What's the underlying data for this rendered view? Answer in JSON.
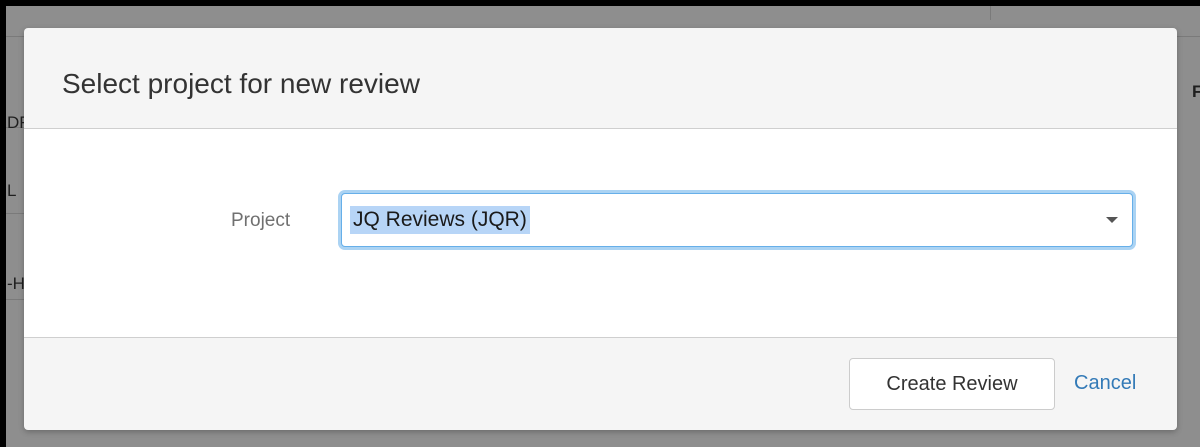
{
  "dialog": {
    "title": "Select project for new review",
    "project_label": "Project",
    "project_value": "JQ Reviews (JQR)",
    "create_label": "Create Review",
    "cancel_label": "Cancel"
  },
  "background": {
    "row_fragments": [
      "DF",
      "L",
      "-H"
    ],
    "right_fragment": "F"
  },
  "colors": {
    "link": "#337ab7",
    "focus_ring": "#66afe9",
    "selection": "#b7d5f7"
  }
}
